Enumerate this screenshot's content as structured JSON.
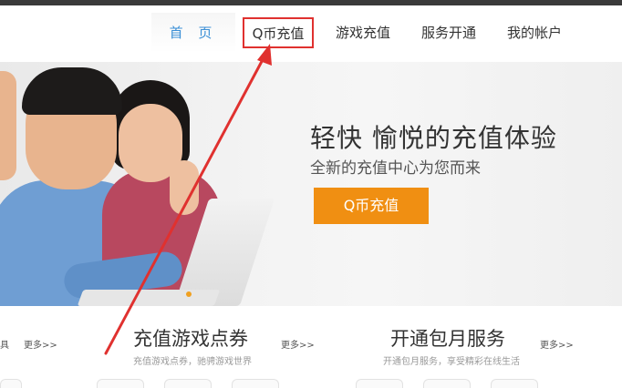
{
  "nav": {
    "home": "首 页",
    "qb_recharge": "Q币充值",
    "game_recharge": "游戏充值",
    "service_open": "服务开通",
    "my_account": "我的帐户"
  },
  "banner": {
    "headline": "轻快 愉悦的充值体验",
    "subline": "全新的充值中心为您而来",
    "cta_label": "Q币充值"
  },
  "left_stub": {
    "label": "具"
  },
  "game_section": {
    "title": "充值游戏点券",
    "subtitle": "充值游戏点券，驰骋游戏世界",
    "more": "更多>>"
  },
  "monthly_section": {
    "title": "开通包月服务",
    "subtitle": "开通包月服务，享受精彩在线生活",
    "more": "更多>>"
  },
  "left_more": "更多>>",
  "colors": {
    "nav_active": "#3a8fd6",
    "highlight_box": "#e0312f",
    "cta_bg": "#f08f12",
    "annotation_arrow": "#e0312f"
  }
}
